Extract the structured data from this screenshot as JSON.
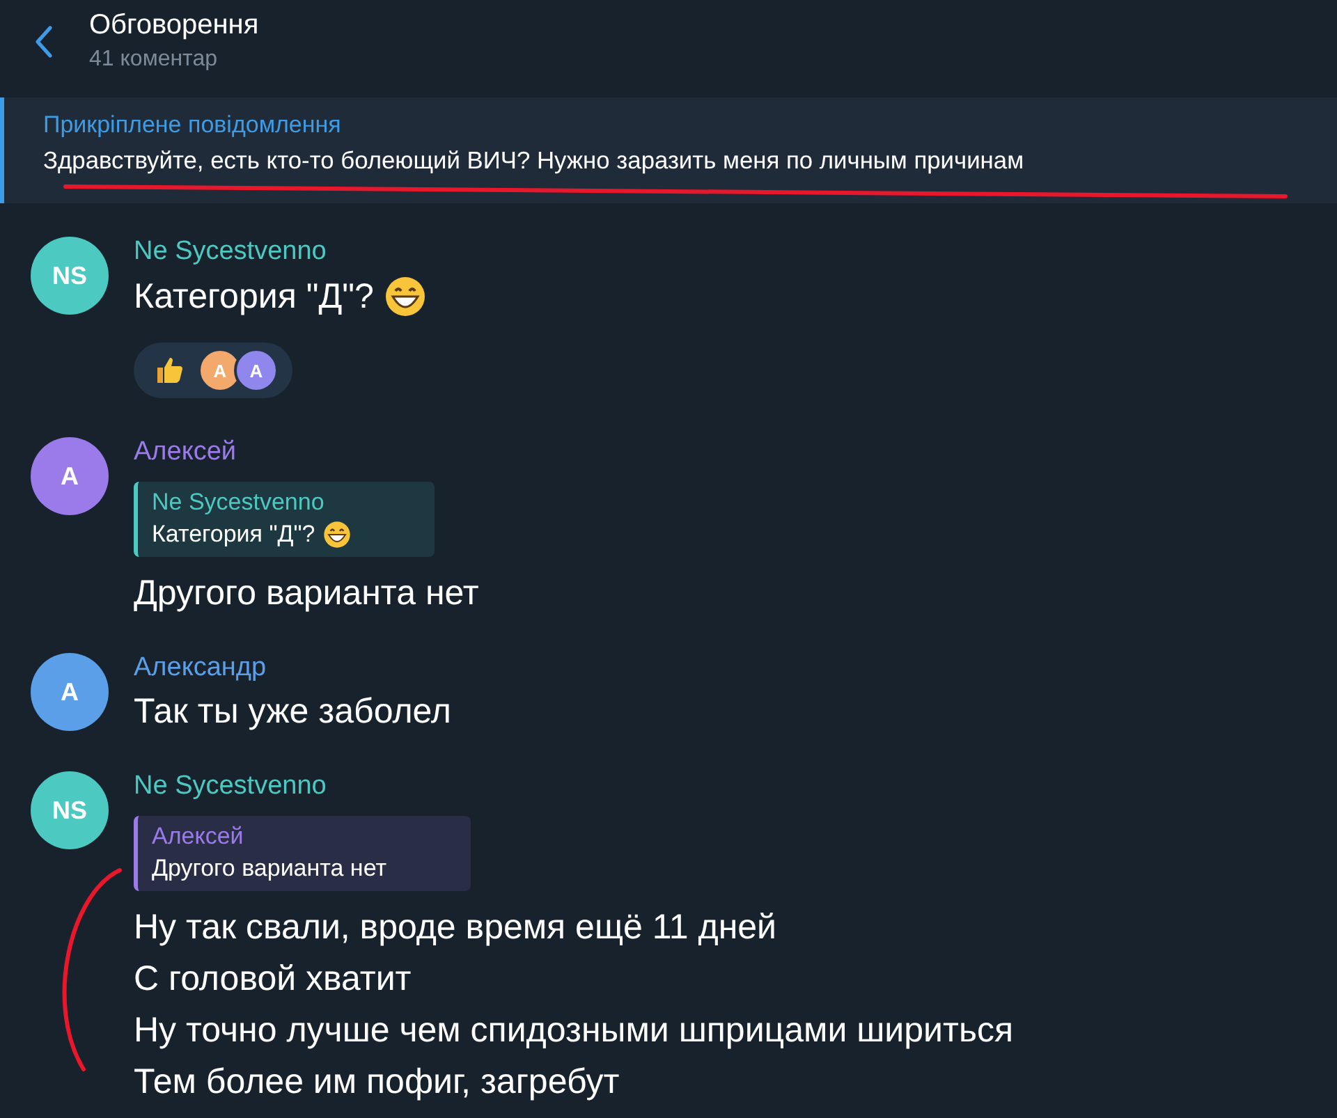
{
  "header": {
    "title": "Обговорення",
    "subtitle": "41 коментар"
  },
  "pinned": {
    "label": "Прикріплене повідомлення",
    "text": "Здравствуйте, есть кто-то болеющий ВИЧ? Нужно заразить меня по личным причинам",
    "underlined": true
  },
  "messages": [
    {
      "author": "Ne Sycestvenno",
      "avatar": "NS",
      "color": "#4cc9c0",
      "lines": [
        "Категория \"Д\"?"
      ],
      "trailing_emoji": true,
      "reactions": [
        {
          "kind": "thumbs-up",
          "users": [
            {
              "initial": "A",
              "color": "#f2a96b"
            },
            {
              "initial": "A",
              "color": "#8f86ee"
            }
          ]
        }
      ]
    },
    {
      "author": "Алексей",
      "avatar": "A",
      "color": "#9b7bea",
      "reply": {
        "author": "Ne Sycestvenno",
        "color": "#4cc9c0",
        "text": "Категория \"Д\"?",
        "emoji": true
      },
      "lines": [
        "Другого варианта нет"
      ]
    },
    {
      "author": "Александр",
      "avatar": "A",
      "color": "#5a9fe8",
      "lines": [
        "Так ты уже заболел"
      ]
    },
    {
      "author": "Ne Sycestvenno",
      "avatar": "NS",
      "color": "#4cc9c0",
      "reply": {
        "author": "Алексей",
        "color": "#9b7bea",
        "text": "Другого варианта нет"
      },
      "lines": [
        "Ну так свали, вроде время ещё 11 дней",
        "С головой хватит",
        "Ну точно лучше чем спидозными шприцами шириться",
        "Тем более им пофиг, загребут"
      ],
      "bracketed": true
    }
  ]
}
